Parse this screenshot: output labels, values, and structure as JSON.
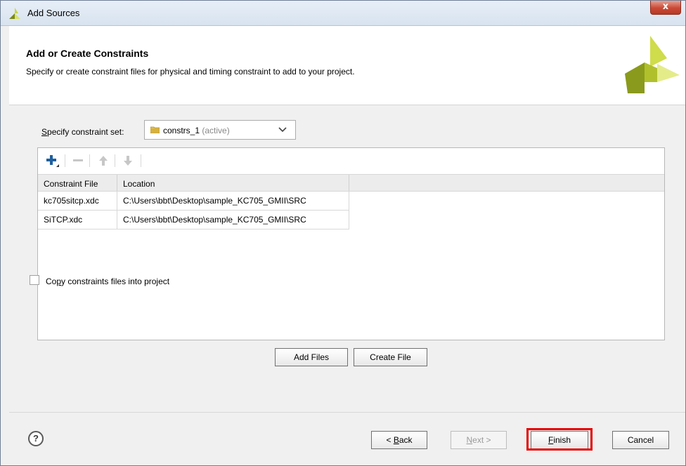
{
  "window": {
    "title": "Add Sources",
    "close_label": "x"
  },
  "header": {
    "title": "Add or Create Constraints",
    "subtitle": "Specify or create constraint files for physical and timing constraint to add to your project."
  },
  "constraint_set": {
    "label_mnemonic": "S",
    "label_rest": "pecify constraint set:",
    "value": "constrs_1",
    "status": "(active)"
  },
  "table": {
    "columns": [
      "Constraint File",
      "Location"
    ],
    "rows": [
      {
        "file": "kc705sitcp.xdc",
        "location": "C:\\Users\\bbt\\Desktop\\sample_KC705_GMII\\SRC"
      },
      {
        "file": "SiTCP.xdc",
        "location": "C:\\Users\\bbt\\Desktop\\sample_KC705_GMII\\SRC"
      }
    ]
  },
  "toolbar_icons": [
    "add-icon",
    "remove-icon",
    "move-up-icon",
    "move-down-icon"
  ],
  "buttons": {
    "add_files": "Add Files",
    "create_file": "Create File",
    "back_prefix": "< ",
    "back_mnemonic": "B",
    "back_rest": "ack",
    "next_mnemonic": "N",
    "next_rest": "ext >",
    "finish_mnemonic": "F",
    "finish_rest": "inish",
    "cancel": "Cancel"
  },
  "copy_option": {
    "label_pre": "Co",
    "label_mnemonic": "p",
    "label_post": "y constraints files into project",
    "checked": false
  },
  "help": {
    "symbol": "?"
  },
  "colors": {
    "accent": "#b9ce3b",
    "highlight": "#e60000",
    "plus": "#1f5f9e"
  }
}
